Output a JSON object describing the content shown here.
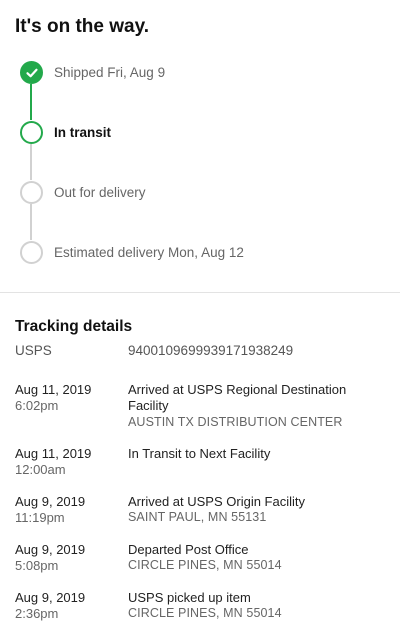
{
  "header": {
    "title": "It's on the way."
  },
  "progress": {
    "steps": [
      {
        "label": "Shipped Fri, Aug 9",
        "state": "done"
      },
      {
        "label": "In transit",
        "state": "active"
      },
      {
        "label": "Out for delivery",
        "state": "pending"
      },
      {
        "label": "Estimated delivery Mon, Aug 12",
        "state": "pending"
      }
    ]
  },
  "tracking": {
    "title": "Tracking details",
    "carrier": "USPS",
    "number": "9400109699939171938249",
    "events": [
      {
        "date": "Aug 11, 2019",
        "time": "6:02pm",
        "description": "Arrived at USPS Regional Destination Facility",
        "location": "AUSTIN TX DISTRIBUTION CENTER"
      },
      {
        "date": "Aug 11, 2019",
        "time": "12:00am",
        "description": "In Transit to Next Facility",
        "location": ""
      },
      {
        "date": "Aug 9, 2019",
        "time": "11:19pm",
        "description": "Arrived at USPS Origin Facility",
        "location": "SAINT PAUL, MN 55131"
      },
      {
        "date": "Aug 9, 2019",
        "time": "5:08pm",
        "description": "Departed Post Office",
        "location": "CIRCLE PINES, MN 55014"
      },
      {
        "date": "Aug 9, 2019",
        "time": "2:36pm",
        "description": "USPS picked up item",
        "location": "CIRCLE PINES, MN 55014"
      }
    ]
  },
  "colors": {
    "accent": "#23a94b",
    "inactive": "#d1d1d1"
  },
  "icons": {
    "done": "checkmark-icon"
  }
}
